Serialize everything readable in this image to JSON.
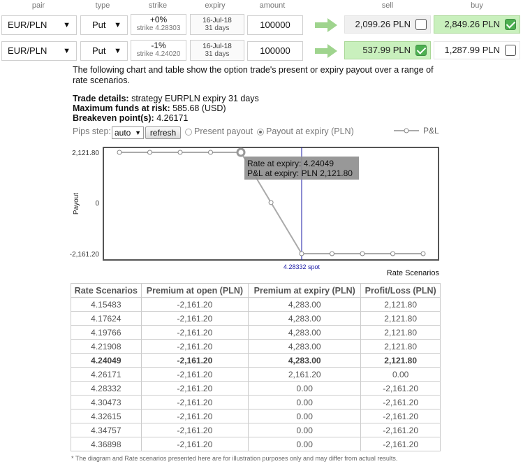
{
  "headers": {
    "pair": "pair",
    "type": "type",
    "strike": "strike",
    "expiry": "expiry",
    "amount": "amount",
    "sell": "sell",
    "buy": "buy"
  },
  "trades": [
    {
      "pair": "EUR/PLN",
      "type": "Put",
      "strike_pct": "+0%",
      "strike_label": "strike 4.28303",
      "expiry_date": "16-Jul-18",
      "expiry_days": "31 days",
      "amount": "100000",
      "sell": "2,099.26 PLN",
      "sell_checked": false,
      "buy": "2,849.26 PLN",
      "buy_checked": true
    },
    {
      "pair": "EUR/PLN",
      "type": "Put",
      "strike_pct": "-1%",
      "strike_label": "strike 4.24020",
      "expiry_date": "16-Jul-18",
      "expiry_days": "31 days",
      "amount": "100000",
      "sell": "537.99 PLN",
      "sell_checked": true,
      "buy": "1,287.99 PLN",
      "buy_checked": false
    }
  ],
  "intro_text": "The following chart and table show the option trade's present or expiry payout over a range of rate scenarios.",
  "details": {
    "trade_label": "Trade details:",
    "trade_value": "strategy EURPLN expiry 31 days",
    "funds_label": "Maximum funds at risk:",
    "funds_value": "585.68 (USD)",
    "breakeven_label": "Breakeven point(s):",
    "breakeven_value": "4.26171"
  },
  "controls": {
    "pips_label": "Pips step:",
    "pips_value": "auto",
    "refresh": "refresh",
    "present": "Present payout",
    "expiry": "Payout at expiry (PLN)",
    "selected": "expiry"
  },
  "legend": "P&L",
  "colors": {
    "arrow": "#9fd48e",
    "green_bg": "#c9f0bd",
    "line": "#aaaaaa",
    "spot": "#1a1aa6"
  },
  "chart_data": {
    "type": "line",
    "ylabel": "Payout",
    "xlabel": "Rate Scenarios",
    "yticks": [
      "2,121.80",
      "0",
      "-2,161.20"
    ],
    "ylim": [
      -2161.2,
      2121.8
    ],
    "x": [
      4.15483,
      4.17624,
      4.19766,
      4.21908,
      4.24049,
      4.26171,
      4.28332,
      4.30473,
      4.32615,
      4.34757,
      4.36898
    ],
    "series": [
      {
        "name": "P&L",
        "values": [
          2121.8,
          2121.8,
          2121.8,
          2121.8,
          2121.8,
          0.0,
          -2161.2,
          -2161.2,
          -2161.2,
          -2161.2,
          -2161.2
        ]
      }
    ],
    "highlight_index": 4,
    "spot": {
      "value": 4.28332,
      "label": "4.28332 spot"
    },
    "tooltip": [
      "Rate at expiry: 4.24049",
      "P&L at expiry: PLN 2,121.80"
    ],
    "grid": false
  },
  "table": {
    "columns": [
      "Rate Scenarios",
      "Premium at open (PLN)",
      "Premium at expiry (PLN)",
      "Profit/Loss (PLN)"
    ],
    "highlight_row": 4,
    "rows": [
      [
        "4.15483",
        "-2,161.20",
        "4,283.00",
        "2,121.80"
      ],
      [
        "4.17624",
        "-2,161.20",
        "4,283.00",
        "2,121.80"
      ],
      [
        "4.19766",
        "-2,161.20",
        "4,283.00",
        "2,121.80"
      ],
      [
        "4.21908",
        "-2,161.20",
        "4,283.00",
        "2,121.80"
      ],
      [
        "4.24049",
        "-2,161.20",
        "4,283.00",
        "2,121.80"
      ],
      [
        "4.26171",
        "-2,161.20",
        "2,161.20",
        "0.00"
      ],
      [
        "4.28332",
        "-2,161.20",
        "0.00",
        "-2,161.20"
      ],
      [
        "4.30473",
        "-2,161.20",
        "0.00",
        "-2,161.20"
      ],
      [
        "4.32615",
        "-2,161.20",
        "0.00",
        "-2,161.20"
      ],
      [
        "4.34757",
        "-2,161.20",
        "0.00",
        "-2,161.20"
      ],
      [
        "4.36898",
        "-2,161.20",
        "0.00",
        "-2,161.20"
      ]
    ]
  },
  "footnote": "* The diagram and Rate scenarios presented here are for illustration purposes only and may differ from actual results."
}
